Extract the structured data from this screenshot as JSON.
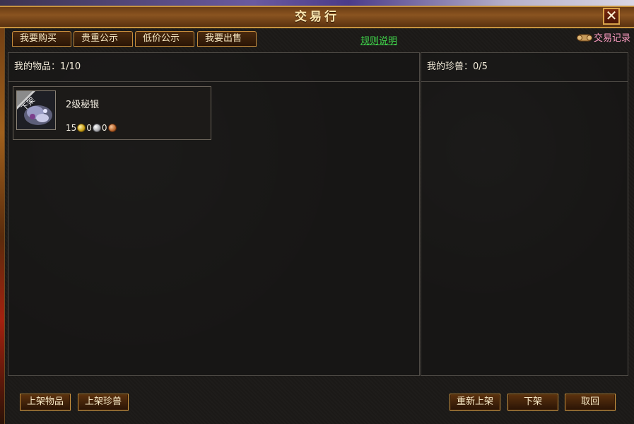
{
  "window": {
    "title": "交易行",
    "close_label": "✕"
  },
  "tabs": [
    {
      "label": "我要购买"
    },
    {
      "label": "贵重公示"
    },
    {
      "label": "低价公示"
    },
    {
      "label": "我要出售"
    }
  ],
  "rules_link": "规则说明",
  "trade_log": "交易记录",
  "items_panel": {
    "header": "我的物品：1/10",
    "item": {
      "name": "2级秘银",
      "badge": "下架",
      "price": {
        "gold": "15",
        "silver": "0",
        "copper": "0"
      }
    }
  },
  "pets_panel": {
    "header": "我的珍兽：0/5"
  },
  "buttons": {
    "list_item": "上架物品",
    "list_pet": "上架珍兽",
    "relist": "重新上架",
    "delist": "下架",
    "cancel": "取回"
  },
  "colors": {
    "frame_gold": "#c8943f",
    "rules_green": "#3fd34a",
    "trade_log_pink": "#ff9ec4"
  }
}
